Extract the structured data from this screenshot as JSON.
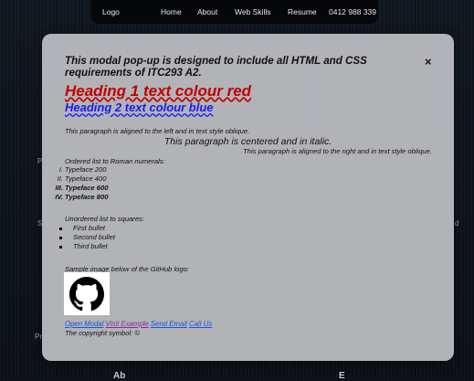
{
  "nav": {
    "logo": "Logo",
    "home": "Home",
    "about": "About",
    "web_skills": "Web Skills",
    "resume": "Resume",
    "phone": "0412 988 339"
  },
  "background": {
    "edge_left_1": "P",
    "edge_left_2": "S",
    "edge_left_3": "Pr",
    "edge_right": "d",
    "bottom_left": "Ab",
    "bottom_right": "E"
  },
  "modal": {
    "close": "×",
    "title": "This modal pop-up is designed to include all HTML and CSS requirements of ITC293 A2.",
    "heading1": "Heading 1 text colour red",
    "heading2": "Heading 2 text colour blue",
    "para_left": "This paragraph is aligned to the left and in text style oblique.",
    "para_center": "This paragraph is centered and in italic.",
    "para_right": "This paragraph is aligned to the right and in text style oblique.",
    "ordered_label": "Ordered list to Roman numerals:",
    "ordered_items": [
      {
        "num": "I.",
        "text": "Typeface 200"
      },
      {
        "num": "II.",
        "text": "Typeface 400"
      },
      {
        "num": "III.",
        "text": "Typeface 600"
      },
      {
        "num": "IV.",
        "text": "Typeface 800"
      }
    ],
    "unordered_label": "Unordered list to squares:",
    "unordered_items": [
      "First bullet",
      "Second bullet",
      "Third bullet"
    ],
    "image_label": "Sample image below of the GitHub logo:",
    "links": {
      "open_modal": "Open Modal",
      "visit_example": "Visit Example",
      "send_email": "Send Email",
      "call_us": "Call Us"
    },
    "copyright": "The copyright symbol: ©"
  }
}
